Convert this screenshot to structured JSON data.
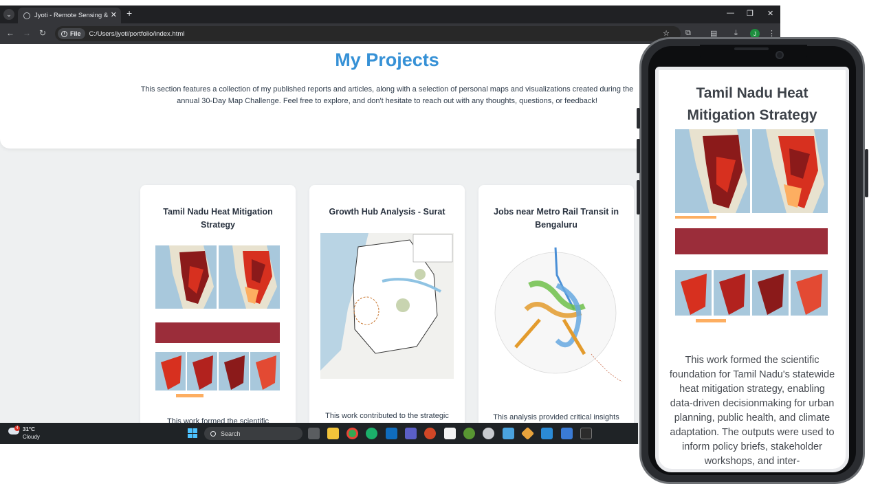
{
  "browser": {
    "tab_title": "Jyoti - Remote Sensing & GIS P",
    "new_tab": "+",
    "url_chip": "File",
    "url": "C:/Users/jyoti/portfolio/index.html",
    "profile_initial": "J"
  },
  "hero": {
    "title": "My Projects",
    "description": "This section features a collection of my published reports and articles, along with a selection of personal maps and visualizations created during the annual 30-Day Map Challenge. Feel free to explore, and don't hesitate to reach out with any thoughts, questions, or feedback!"
  },
  "cards": [
    {
      "title": "Tamil Nadu Heat Mitigation Strategy",
      "snippet": "This work formed the scientific"
    },
    {
      "title": "Growth Hub Analysis - Surat",
      "snippet": "This work contributed to the strategic"
    },
    {
      "title": "Jobs near Metro Rail Transit in Bengaluru",
      "snippet": "This analysis provided critical insights"
    }
  ],
  "taskbar": {
    "temperature": "31°C",
    "condition": "Cloudy",
    "weather_badge": "4",
    "search_placeholder": "Search"
  },
  "phone": {
    "title": "Tamil Nadu Heat Mitigation Strategy",
    "description": "This work formed the scientific foundation for Tamil Nadu's statewide heat mitigation strategy, enabling data-driven decisionmaking for urban planning, public health, and climate adaptation. The outputs were used to inform policy briefs, stakeholder workshops, and inter-"
  },
  "colors": {
    "accent": "#3691d6",
    "heat_dark": "#8b1a1a",
    "heat_mid": "#d7301f",
    "heat_light": "#fdae61",
    "banner": "#9b2d3a"
  }
}
